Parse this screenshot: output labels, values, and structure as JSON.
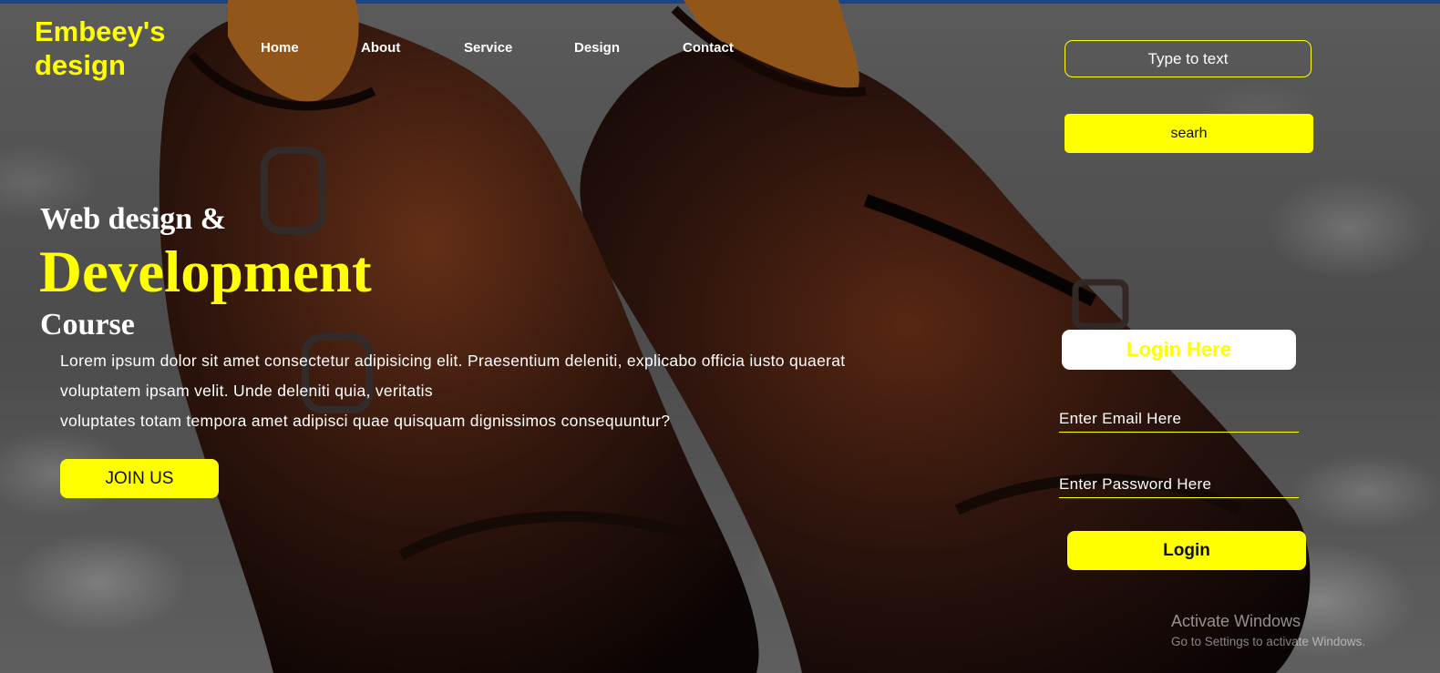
{
  "brand": {
    "line1": "Embeey's",
    "line2": "design"
  },
  "nav": {
    "items": [
      {
        "label": "Home"
      },
      {
        "label": "About"
      },
      {
        "label": "Service"
      },
      {
        "label": "Design"
      },
      {
        "label": "Contact"
      }
    ]
  },
  "search": {
    "placeholder": "Type to text",
    "button_label": "searh"
  },
  "hero": {
    "line1": "Web design &",
    "line2": "Development",
    "line3": "Course",
    "paragraph": [
      "Lorem ipsum dolor sit amet consectetur adipisicing elit. Praesentium deleniti, explicabo officia iusto quaerat",
      "voluptatem ipsam velit. Unde deleniti quia, veritatis",
      "voluptates totam tempora amet adipisci quae quisquam dignissimos consequuntur?"
    ],
    "join_label": "JOIN US"
  },
  "login": {
    "heading": "Login Here",
    "email_placeholder": "Enter Email Here",
    "password_placeholder": "Enter Password Here",
    "button_label": "Login"
  },
  "watermark": {
    "title": "Activate Windows",
    "subtitle": "Go to Settings to activate Windows."
  },
  "colors": {
    "accent": "#ffff00",
    "top_strip": "#1f55a6",
    "text": "#ffffff"
  },
  "background": {
    "image_subject": "pair of dark brown monk-strap leather shoes on white pebbles"
  }
}
